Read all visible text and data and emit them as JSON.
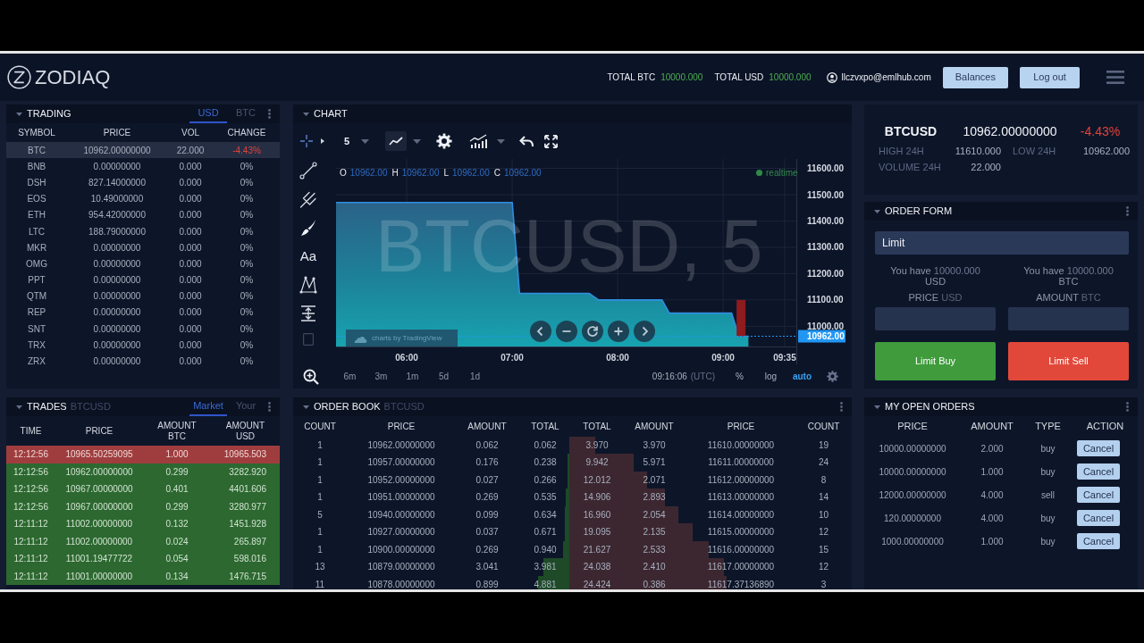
{
  "header": {
    "logo": "ZODIAQ",
    "totals": [
      {
        "label": "TOTAL BTC",
        "value": "10000.000"
      },
      {
        "label": "TOTAL USD",
        "value": "10000.000"
      }
    ],
    "user_email": "llczvxpo@emlhub.com",
    "buttons": [
      "Balances",
      "Log out"
    ]
  },
  "trading": {
    "title": "TRADING",
    "tabs": [
      {
        "label": "USD",
        "selected": true
      },
      {
        "label": "BTC",
        "selected": false
      }
    ],
    "columns": [
      "SYMBOL",
      "PRICE",
      "VOL",
      "CHANGE"
    ],
    "rows": [
      {
        "symbol": "BTC",
        "price": "10962.00000000",
        "vol": "22.000",
        "change": "-4.43%",
        "negative": true,
        "selected": true
      },
      {
        "symbol": "BNB",
        "price": "0.00000000",
        "vol": "0.000",
        "change": "0%",
        "negative": false,
        "selected": false
      },
      {
        "symbol": "DSH",
        "price": "827.14000000",
        "vol": "0.000",
        "change": "0%",
        "negative": false,
        "selected": false
      },
      {
        "symbol": "EOS",
        "price": "10.49000000",
        "vol": "0.000",
        "change": "0%",
        "negative": false,
        "selected": false
      },
      {
        "symbol": "ETH",
        "price": "954.42000000",
        "vol": "0.000",
        "change": "0%",
        "negative": false,
        "selected": false
      },
      {
        "symbol": "LTC",
        "price": "188.79000000",
        "vol": "0.000",
        "change": "0%",
        "negative": false,
        "selected": false
      },
      {
        "symbol": "MKR",
        "price": "0.00000000",
        "vol": "0.000",
        "change": "0%",
        "negative": false,
        "selected": false
      },
      {
        "symbol": "OMG",
        "price": "0.00000000",
        "vol": "0.000",
        "change": "0%",
        "negative": false,
        "selected": false
      },
      {
        "symbol": "PPT",
        "price": "0.00000000",
        "vol": "0.000",
        "change": "0%",
        "negative": false,
        "selected": false
      },
      {
        "symbol": "QTM",
        "price": "0.00000000",
        "vol": "0.000",
        "change": "0%",
        "negative": false,
        "selected": false
      },
      {
        "symbol": "REP",
        "price": "0.00000000",
        "vol": "0.000",
        "change": "0%",
        "negative": false,
        "selected": false
      },
      {
        "symbol": "SNT",
        "price": "0.00000000",
        "vol": "0.000",
        "change": "0%",
        "negative": false,
        "selected": false
      },
      {
        "symbol": "TRX",
        "price": "0.00000000",
        "vol": "0.000",
        "change": "0%",
        "negative": false,
        "selected": false
      },
      {
        "symbol": "ZRX",
        "price": "0.00000000",
        "vol": "0.000",
        "change": "0%",
        "negative": false,
        "selected": false
      }
    ]
  },
  "chart": {
    "title": "CHART",
    "interval": "5",
    "text_tool": "Aa",
    "legend": [
      {
        "label": "O",
        "value": "10962.00"
      },
      {
        "label": "H",
        "value": "10962.00"
      },
      {
        "label": "L",
        "value": "10962.00"
      },
      {
        "label": "C",
        "value": "10962.00"
      }
    ],
    "status": "realtime",
    "symbol_watermark": "BTCUSD, 5",
    "attribution": "charts by TradingView",
    "chart_data": [
      {
        "type": "area",
        "xlim": [
          5.33,
          9.694
        ],
        "ylim": [
          10923,
          11629
        ],
        "xticks": [
          {
            "value": 6,
            "label": "06:00"
          },
          {
            "value": 7,
            "label": "07:00"
          },
          {
            "value": 8,
            "label": "08:00"
          },
          {
            "value": 9,
            "label": "09:00"
          },
          {
            "value": 9.5833,
            "label": "09:35"
          }
        ],
        "yticks": [
          {
            "value": 11000,
            "label": "11000.00"
          },
          {
            "value": 11100,
            "label": "11100.00"
          },
          {
            "value": 11200,
            "label": "11200.00"
          },
          {
            "value": 11300,
            "label": "11300.00"
          },
          {
            "value": 11400,
            "label": "11400.00"
          },
          {
            "value": 11500,
            "label": "11500.00"
          },
          {
            "value": 11600,
            "label": "11600.00"
          }
        ],
        "grid": true,
        "series": [
          {
            "color": "#2f8fe0",
            "x": [
              5.33,
              7.0,
              7.07,
              7.73,
              7.82,
              8.42,
              8.49,
              9.08,
              9.15,
              9.24
            ],
            "values": [
              11470,
              11470,
              11125,
              11125,
              11100,
              11100,
              11050,
              11050,
              10962,
              10962
            ]
          },
          {
            "type": "candlestick",
            "color": "#8e1b1e",
            "x": [
              9.17
            ],
            "ohlc": [
              [
                11100,
                11100,
                10962,
                10962
              ]
            ]
          }
        ],
        "ref_lines": [
          {
            "axis": "y",
            "value": 10962,
            "label": "10962.00",
            "color": "#2196f3",
            "line_style": "dotted"
          }
        ]
      }
    ],
    "timeframes": [
      "6m",
      "3m",
      "1m",
      "5d",
      "1d"
    ],
    "clock_time": "09:16:06",
    "clock_zone": "(UTC)",
    "scale_options": [
      {
        "label": "%",
        "selected": false
      },
      {
        "label": "log",
        "selected": false
      },
      {
        "label": "auto",
        "selected": true
      }
    ]
  },
  "ticker": {
    "symbol": "BTCUSD",
    "price": "10962.00000000",
    "change": "-4.43%",
    "negative": true,
    "stats": [
      {
        "label": "HIGH 24H",
        "value": "11610.000"
      },
      {
        "label": "LOW 24H",
        "value": "10962.000"
      },
      {
        "label": "VOLUME 24H",
        "value": "22.000"
      }
    ]
  },
  "order_form": {
    "title": "ORDER FORM",
    "order_type": "Limit",
    "sides": [
      {
        "kind": "buy",
        "balance_label": "You have",
        "balance": "10000.000",
        "balance_currency": "USD",
        "field_label": "PRICE",
        "field_unit": "USD",
        "button": "Limit Buy"
      },
      {
        "kind": "sell",
        "balance_label": "You have",
        "balance": "10000.000",
        "balance_currency": "BTC",
        "field_label": "AMOUNT",
        "field_unit": "BTC",
        "button": "Limit Sell"
      }
    ]
  },
  "trades": {
    "title": "TRADES",
    "pair": "BTCUSD",
    "tabs": [
      {
        "label": "Market",
        "selected": true
      },
      {
        "label": "Your",
        "selected": false
      }
    ],
    "columns": [
      "TIME",
      "PRICE",
      "AMOUNT BTC",
      "AMOUNT USD"
    ],
    "rows": [
      {
        "kind": "sell",
        "time": "12:12:56",
        "price": "10965.50259095",
        "amount_btc": "1.000",
        "amount_usd": "10965.503"
      },
      {
        "kind": "buy",
        "time": "12:12:56",
        "price": "10962.00000000",
        "amount_btc": "0.299",
        "amount_usd": "3282.920"
      },
      {
        "kind": "buy",
        "time": "12:12:56",
        "price": "10967.00000000",
        "amount_btc": "0.401",
        "amount_usd": "4401.606"
      },
      {
        "kind": "buy",
        "time": "12:12:56",
        "price": "10967.00000000",
        "amount_btc": "0.299",
        "amount_usd": "3280.977"
      },
      {
        "kind": "buy",
        "time": "12:11:12",
        "price": "11002.00000000",
        "amount_btc": "0.132",
        "amount_usd": "1451.928"
      },
      {
        "kind": "buy",
        "time": "12:11:12",
        "price": "11002.00000000",
        "amount_btc": "0.024",
        "amount_usd": "265.897"
      },
      {
        "kind": "buy",
        "time": "12:11:12",
        "price": "11001.19477722",
        "amount_btc": "0.054",
        "amount_usd": "598.016"
      },
      {
        "kind": "buy",
        "time": "12:11:12",
        "price": "11001.00000000",
        "amount_btc": "0.134",
        "amount_usd": "1476.715"
      }
    ]
  },
  "order_book": {
    "title": "ORDER BOOK",
    "pair": "BTCUSD",
    "columns": [
      "COUNT",
      "PRICE",
      "AMOUNT",
      "TOTAL",
      "TOTAL",
      "AMOUNT",
      "PRICE",
      "COUNT"
    ],
    "rows": [
      {
        "bid_count": "1",
        "bid_price": "10962.00000000",
        "bid_amount": "0.062",
        "bid_total": "0.062",
        "ask_total": "3.970",
        "ask_amount": "3.970",
        "ask_price": "11610.00000000",
        "ask_count": "19"
      },
      {
        "bid_count": "1",
        "bid_price": "10957.00000000",
        "bid_amount": "0.176",
        "bid_total": "0.238",
        "ask_total": "9.942",
        "ask_amount": "5.971",
        "ask_price": "11611.00000000",
        "ask_count": "24"
      },
      {
        "bid_count": "1",
        "bid_price": "10952.00000000",
        "bid_amount": "0.027",
        "bid_total": "0.266",
        "ask_total": "12.012",
        "ask_amount": "2.071",
        "ask_price": "11612.00000000",
        "ask_count": "8"
      },
      {
        "bid_count": "1",
        "bid_price": "10951.00000000",
        "bid_amount": "0.269",
        "bid_total": "0.535",
        "ask_total": "14.906",
        "ask_amount": "2.893",
        "ask_price": "11613.00000000",
        "ask_count": "14"
      },
      {
        "bid_count": "5",
        "bid_price": "10940.00000000",
        "bid_amount": "0.099",
        "bid_total": "0.634",
        "ask_total": "16.960",
        "ask_amount": "2.054",
        "ask_price": "11614.00000000",
        "ask_count": "10"
      },
      {
        "bid_count": "1",
        "bid_price": "10927.00000000",
        "bid_amount": "0.037",
        "bid_total": "0.671",
        "ask_total": "19.095",
        "ask_amount": "2.135",
        "ask_price": "11615.00000000",
        "ask_count": "12"
      },
      {
        "bid_count": "1",
        "bid_price": "10900.00000000",
        "bid_amount": "0.269",
        "bid_total": "0.940",
        "ask_total": "21.627",
        "ask_amount": "2.533",
        "ask_price": "11616.00000000",
        "ask_count": "15"
      },
      {
        "bid_count": "13",
        "bid_price": "10879.00000000",
        "bid_amount": "3.041",
        "bid_total": "3.981",
        "ask_total": "24.038",
        "ask_amount": "2.410",
        "ask_price": "11617.00000000",
        "ask_count": "12"
      },
      {
        "bid_count": "11",
        "bid_price": "10878.00000000",
        "bid_amount": "0.899",
        "bid_total": "4.881",
        "ask_total": "24.424",
        "ask_amount": "0.386",
        "ask_price": "11617.37136890",
        "ask_count": "3"
      }
    ]
  },
  "open_orders": {
    "title": "MY OPEN ORDERS",
    "columns": [
      "PRICE",
      "AMOUNT",
      "TYPE",
      "ACTION"
    ],
    "rows": [
      {
        "price": "10000.00000000",
        "amount": "2.000",
        "type": "buy",
        "action": "Cancel"
      },
      {
        "price": "10000.00000000",
        "amount": "1.000",
        "type": "buy",
        "action": "Cancel"
      },
      {
        "price": "12000.00000000",
        "amount": "4.000",
        "type": "sell",
        "action": "Cancel"
      },
      {
        "price": "120.00000000",
        "amount": "4.000",
        "type": "buy",
        "action": "Cancel"
      },
      {
        "price": "1000.00000000",
        "amount": "1.000",
        "type": "buy",
        "action": "Cancel"
      }
    ]
  }
}
